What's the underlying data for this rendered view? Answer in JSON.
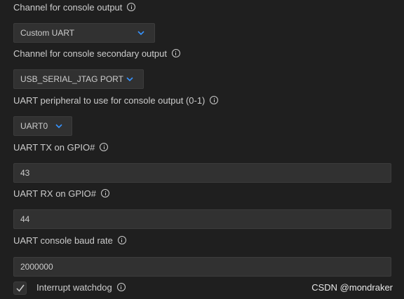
{
  "settings": {
    "console_channel": {
      "label": "Channel for console output",
      "value": "Custom UART"
    },
    "console_secondary": {
      "label": "Channel for console secondary output",
      "value": "USB_SERIAL_JTAG PORT"
    },
    "uart_peripheral": {
      "label": "UART peripheral to use for console output (0-1)",
      "value": "UART0"
    },
    "uart_tx": {
      "label": "UART TX on GPIO#",
      "value": "43"
    },
    "uart_rx": {
      "label": "UART RX on GPIO#",
      "value": "44"
    },
    "baud_rate": {
      "label": "UART console baud rate",
      "value": "2000000"
    },
    "interrupt_watchdog": {
      "label": "Interrupt watchdog",
      "checked": true
    }
  },
  "watermark": "CSDN @mondraker",
  "colors": {
    "background": "#1f1f1f",
    "field": "#313131",
    "text": "#cccccc",
    "chevron": "#3794ff"
  },
  "icons": {
    "info": "info-circle-icon",
    "chevron": "chevron-down-icon",
    "check": "checkmark-icon"
  }
}
